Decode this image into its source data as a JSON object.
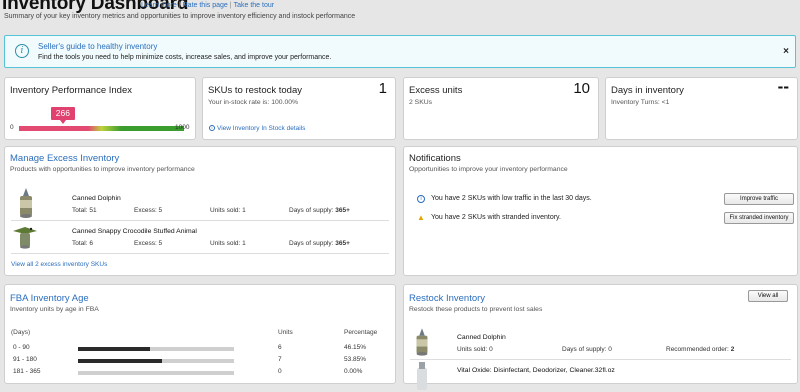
{
  "header": {
    "title": "Inventory Dashboard",
    "links": [
      "Learn more",
      "Rate this page",
      "Take the tour"
    ],
    "subtitle": "Summary of your key inventory metrics and opportunities to improve inventory efficiency and instock performance"
  },
  "alert": {
    "title": "Seller's guide to healthy inventory",
    "text": "Find the tools you need to help minimize costs, increase sales, and improve your performance.",
    "close": "×"
  },
  "ipi": {
    "title": "Inventory Performance Index",
    "score": 266,
    "min": "0",
    "max": "1000"
  },
  "restock_today": {
    "title": "SKUs to restock today",
    "value": "1",
    "sub": "Your in-stock rate is: 100.00%",
    "link": "View Inventory In Stock details"
  },
  "excess_units": {
    "title": "Excess units",
    "value": "10",
    "sub": "2 SKUs"
  },
  "days_inventory": {
    "title": "Days in inventory",
    "value": "--",
    "sub": "Inventory Turns: <1"
  },
  "manage_excess": {
    "title": "Manage Excess Inventory",
    "sub": "Products with opportunities to improve inventory performance",
    "items": [
      {
        "name": "Canned Dolphin",
        "total": "Total: 51",
        "excess": "Excess: 5",
        "sold": "Units sold: 1",
        "supply_label": "Days of supply:",
        "supply_value": "365+"
      },
      {
        "name": "Canned Snappy Crocodile Stuffed Animal",
        "total": "Total: 6",
        "excess": "Excess: 5",
        "sold": "Units sold: 1",
        "supply_label": "Days of supply:",
        "supply_value": "365+"
      }
    ],
    "view_all": "View all 2 excess inventory SKUs"
  },
  "notifications": {
    "title": "Notifications",
    "sub": "Opportunities to improve your inventory performance",
    "items": [
      {
        "icon": "info-icon",
        "text": "You have 2 SKUs with low traffic in the last 30 days.",
        "button": "Improve traffic"
      },
      {
        "icon": "warning-icon",
        "text": "You have 2 SKUs with stranded inventory.",
        "button": "Fix stranded inventory"
      }
    ]
  },
  "fba_age": {
    "title": "FBA Inventory Age",
    "sub": "Inventory units by age in FBA",
    "headers": {
      "days": "(Days)",
      "units": "Units",
      "pct": "Percentage"
    },
    "rows": [
      {
        "range": "0 - 90",
        "units": "6",
        "pct": "46.15%",
        "fraction": 0.4615
      },
      {
        "range": "91 - 180",
        "units": "7",
        "pct": "53.85%",
        "fraction": 0.5385
      },
      {
        "range": "181 - 365",
        "units": "0",
        "pct": "0.00%",
        "fraction": 0
      }
    ]
  },
  "restock": {
    "title": "Restock Inventory",
    "sub": "Restock these products to prevent lost sales",
    "button": "View all",
    "items": [
      {
        "name": "Canned Dolphin",
        "sold": "Units sold: 0",
        "supply": "Days of supply: 0",
        "rec_label": "Recommended order:",
        "rec_value": "2"
      },
      {
        "name": "Vital Oxide: Disinfectant, Deodorizer, Cleaner.32fl.oz"
      }
    ]
  },
  "colors": {
    "link": "#2a6ebd",
    "ipi_marker": "#e0416f",
    "ipi_low": "#e24a72",
    "ipi_high": "#3c9d2f",
    "alert_border": "#57c3d6",
    "warning": "#e3a800"
  }
}
